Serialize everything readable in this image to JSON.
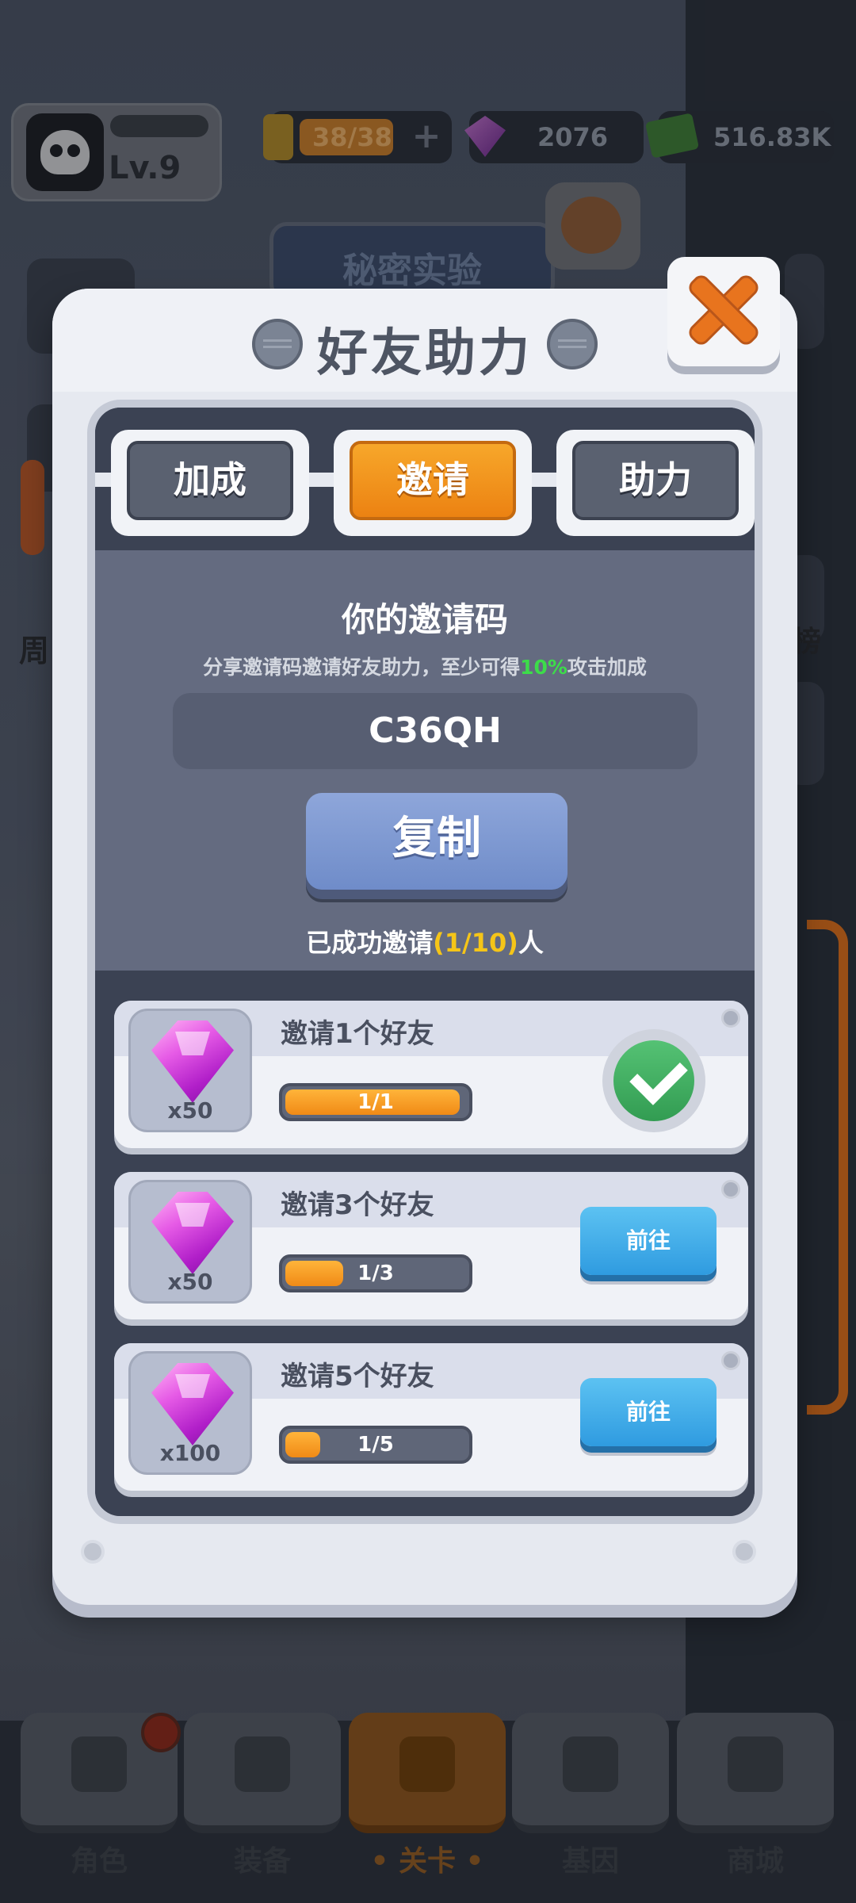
{
  "hud": {
    "level": "Lv.9",
    "energy": "38/38",
    "energy_plus": "+",
    "gems": "2076",
    "cash": "516.83K"
  },
  "background": {
    "secret_lab": "秘密实验",
    "left_partial": "周",
    "right_partial": "榜"
  },
  "modal": {
    "title": "好友助力",
    "tabs": [
      {
        "label": "加成",
        "active": false
      },
      {
        "label": "邀请",
        "active": true
      },
      {
        "label": "助力",
        "active": false
      }
    ],
    "invite": {
      "heading": "你的邀请码",
      "desc_prefix": "分享邀请码邀请好友助力，至少可得",
      "desc_highlight": "10%",
      "desc_suffix": "攻击加成",
      "code": "C36QH",
      "copy_label": "复制",
      "invited_prefix": "已成功邀请",
      "invited_count": "(1/10)",
      "invited_suffix": "人"
    },
    "rewards": [
      {
        "title": "邀请1个好友",
        "reward_qty": "x50",
        "progress_text": "1/1",
        "progress": 1.0,
        "status": "claimed"
      },
      {
        "title": "邀请3个好友",
        "reward_qty": "x50",
        "progress_text": "1/3",
        "progress": 0.333,
        "status": "go",
        "button_label": "前往"
      },
      {
        "title": "邀请5个好友",
        "reward_qty": "x100",
        "progress_text": "1/5",
        "progress": 0.2,
        "status": "go",
        "button_label": "前往"
      }
    ]
  },
  "nav": {
    "items": [
      {
        "label": "角色"
      },
      {
        "label": "装备"
      },
      {
        "label": "• 关卡 •"
      },
      {
        "label": "基因"
      },
      {
        "label": "商城"
      }
    ]
  },
  "colors": {
    "accent_orange": "#f08a16",
    "highlight_green": "#3ddc4a",
    "highlight_yellow": "#f5c518",
    "go_blue": "#2f9be0"
  }
}
